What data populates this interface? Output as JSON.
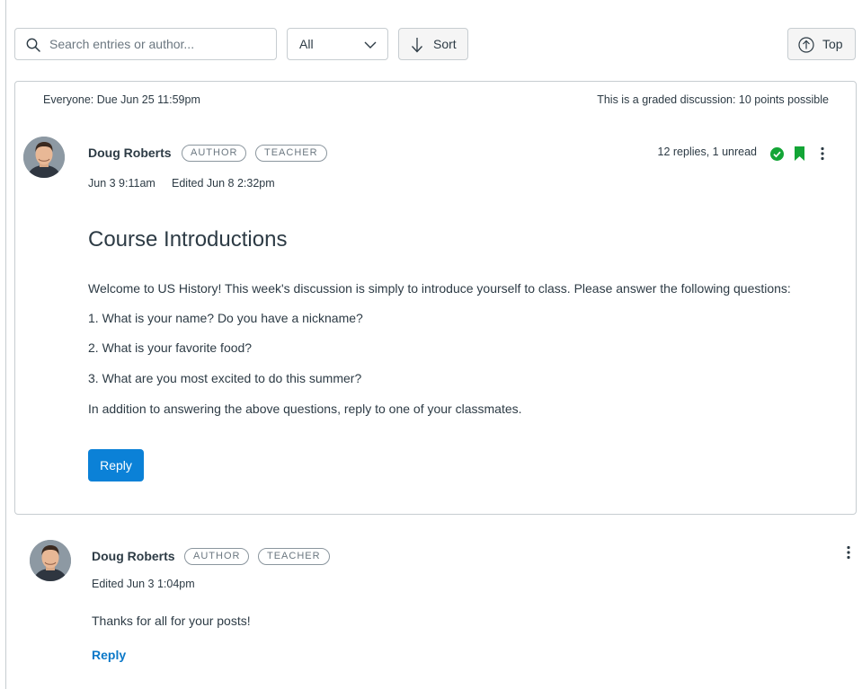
{
  "toolbar": {
    "search_placeholder": "Search entries or author...",
    "filter_value": "All",
    "sort_label": "Sort",
    "top_label": "Top"
  },
  "topic": {
    "due": "Everyone: Due Jun 25 11:59pm",
    "graded_info": "This is a graded discussion: 10 points possible",
    "author": {
      "name": "Doug Roberts",
      "badges": [
        "AUTHOR",
        "TEACHER"
      ]
    },
    "posted": "Jun 3 9:11am",
    "edited": "Edited Jun 8 2:32pm",
    "replies_status": "12 replies, 1 unread",
    "title": "Course Introductions",
    "body": [
      "Welcome to US History! This week's discussion is simply to introduce yourself to class. Please answer the following questions:",
      "1. What is your name? Do you have a nickname?",
      "2. What is your favorite food?",
      "3. What are you most excited to do this summer?",
      "In addition to answering the above questions, reply to one of your classmates."
    ],
    "reply_label": "Reply"
  },
  "entry": {
    "author": {
      "name": "Doug Roberts",
      "badges": [
        "AUTHOR",
        "TEACHER"
      ]
    },
    "edited": "Edited Jun 3 1:04pm",
    "message": "Thanks for all for your posts!",
    "reply_label": "Reply"
  },
  "colors": {
    "primary_button": "#0b81d7",
    "link": "#0b78c8",
    "success": "#13a536",
    "border": "#c7cdd1"
  },
  "icons": {
    "search": "search-icon",
    "dropdown": "chevron-down-icon",
    "sort": "arrow-down-icon",
    "top": "arrow-up-circle-icon",
    "read": "check-circle-icon",
    "bookmark": "bookmark-icon",
    "more": "more-vertical-icon"
  }
}
